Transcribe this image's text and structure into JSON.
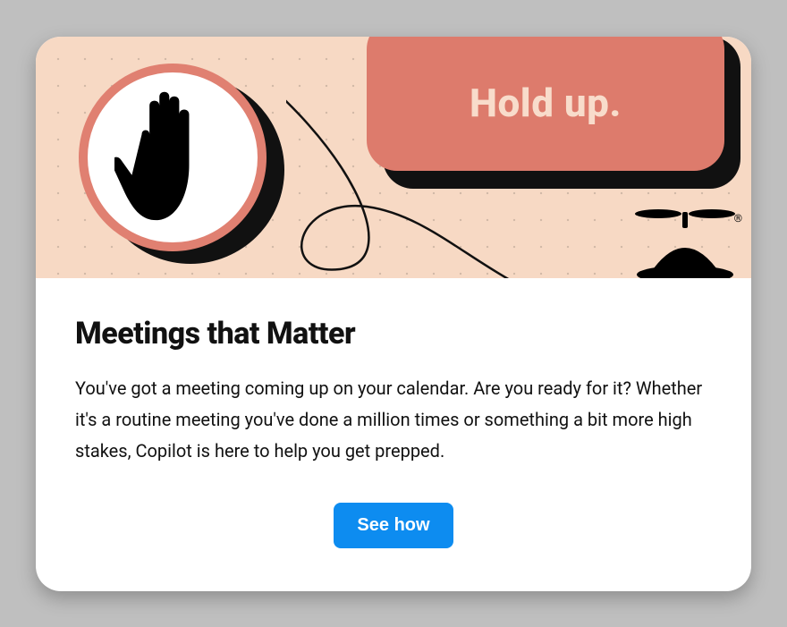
{
  "hero": {
    "banner_text": "Hold up.",
    "hand_icon": "hand-stop-icon",
    "logo_icon": "beanie-cap-icon"
  },
  "content": {
    "title": "Meetings that Matter",
    "body": "You've got a meeting coming up on your calendar. Are you ready for it? Whether it's a routine meeting you've done a million times or something a bit more high stakes, Copilot is here to help you get prepped.",
    "cta_label": "See how"
  },
  "colors": {
    "hero_bg": "#f7d9c4",
    "banner": "#dd7b6c",
    "banner_text": "#f8dccb",
    "circle_border": "#e08071",
    "cta": "#0d8cf0"
  }
}
